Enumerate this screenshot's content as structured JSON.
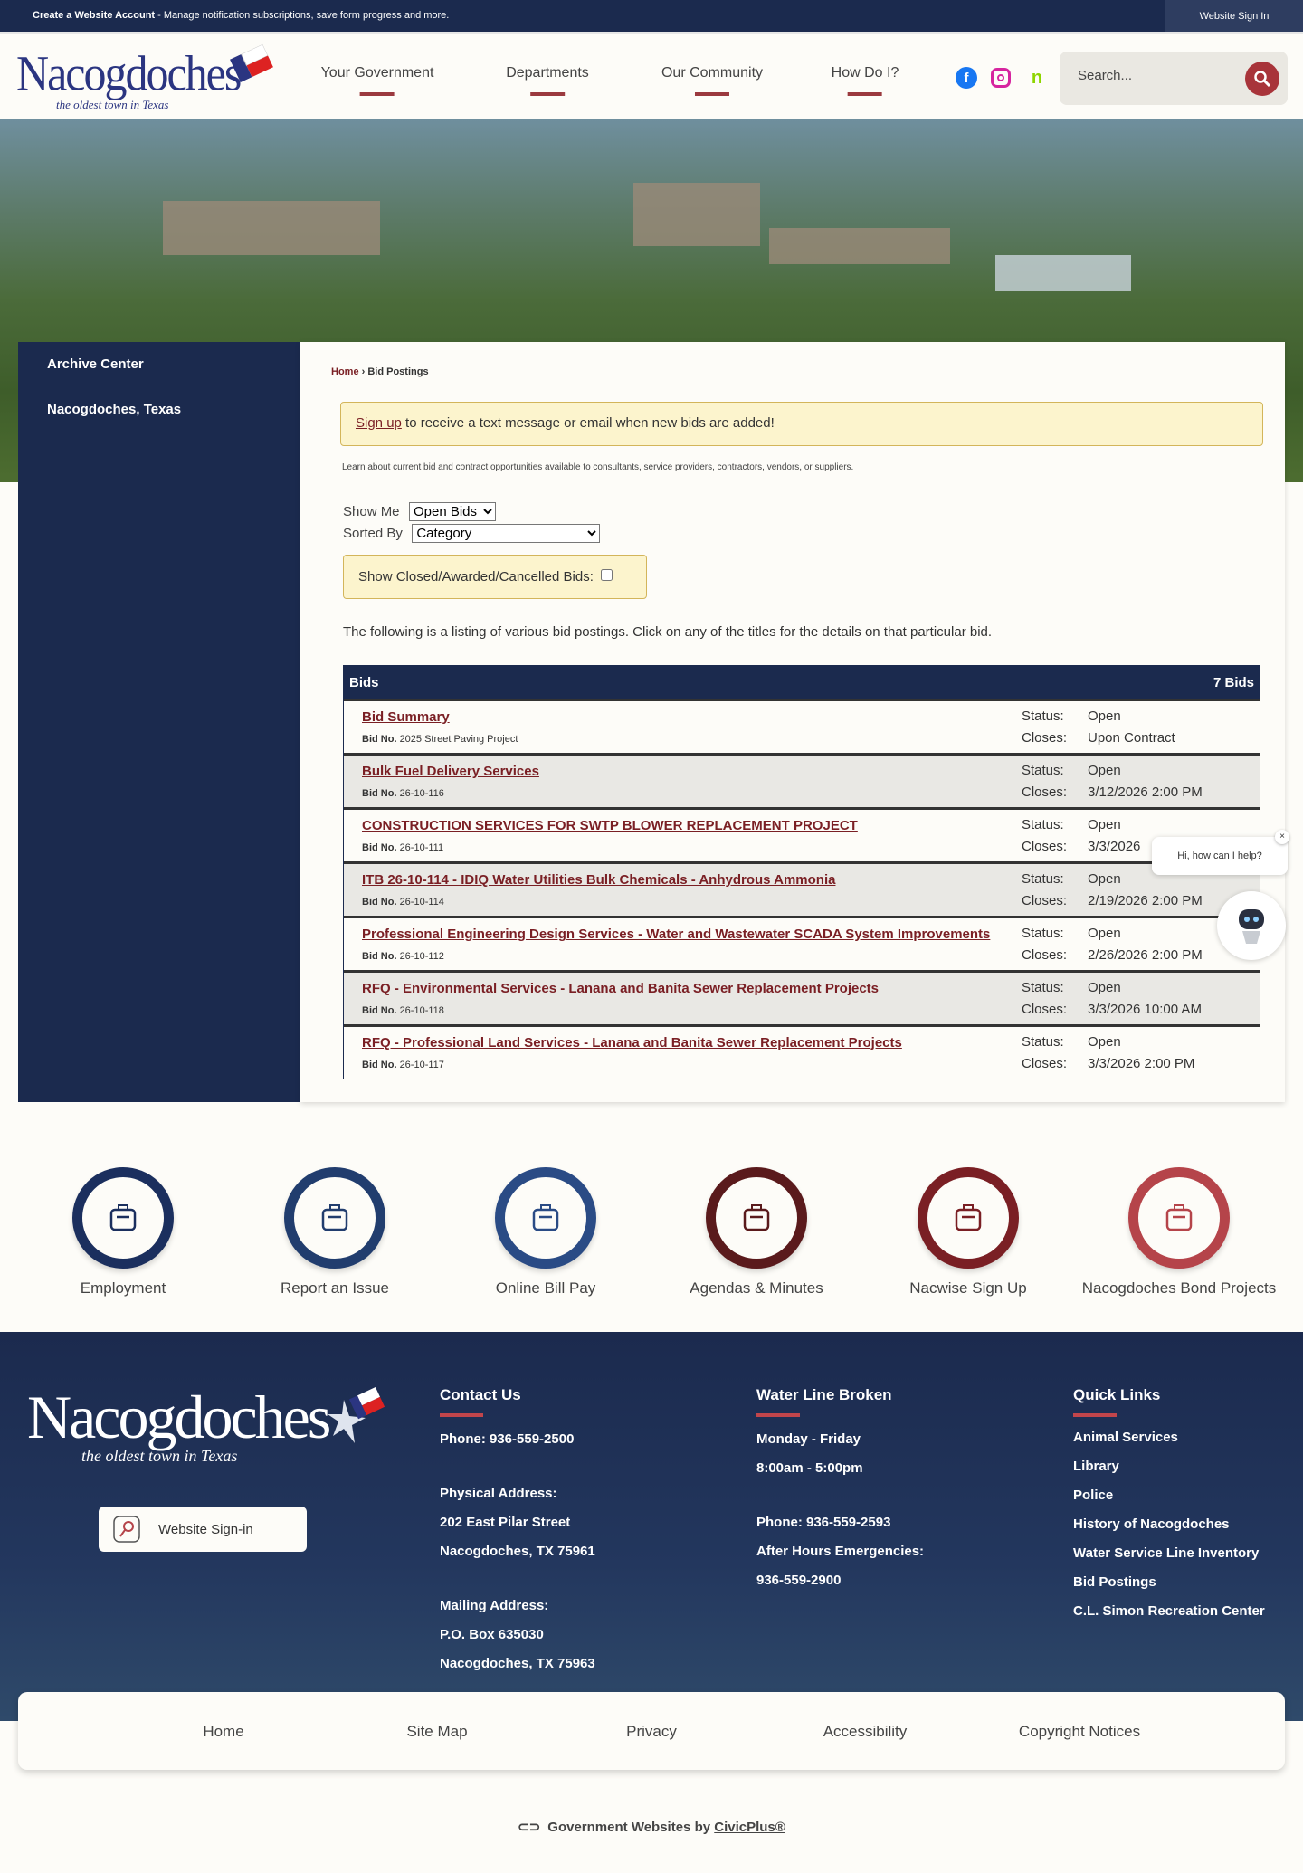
{
  "topbar": {
    "create_account": "Create a Website Account",
    "create_account_desc": " - Manage notification subscriptions, save form progress and more.",
    "sign_in": "Website Sign In"
  },
  "header": {
    "logo_name": "Nacogdoches",
    "logo_tagline": "the oldest town in Texas",
    "nav": [
      "Your Government",
      "Departments",
      "Our Community",
      "How Do I?"
    ],
    "social": [
      "facebook-icon",
      "instagram-icon",
      "nextdoor-icon"
    ],
    "search_placeholder": "Search..."
  },
  "sidebar": {
    "items": [
      "Archive Center",
      "Nacogdoches, Texas"
    ]
  },
  "breadcrumb": {
    "home": "Home",
    "sep": " › ",
    "current": "Bid Postings"
  },
  "alert": {
    "link": "Sign up",
    "text": " to receive a text message or email when new bids are added!"
  },
  "intro": "Learn about current bid and contract opportunities available to consultants, service providers, contractors, vendors, or suppliers.",
  "filters": {
    "show_me_label": "Show Me",
    "show_me_value": "Open Bids",
    "sorted_by_label": "Sorted By",
    "sorted_by_value": "Category",
    "closed_label": "Show Closed/Awarded/Cancelled Bids:"
  },
  "listing_text": "The following is a listing of various bid postings. Click on any of the titles for the details on that particular bid.",
  "table": {
    "title": "Bids",
    "count": "7 Bids",
    "bid_no_label": "Bid No.",
    "status_label": "Status:",
    "closes_label": "Closes:",
    "rows": [
      {
        "title": "Bid Summary",
        "bid_no": "2025 Street Paving Project",
        "status": "Open",
        "closes": "Upon Contract"
      },
      {
        "title": "Bulk Fuel Delivery Services",
        "bid_no": "26-10-116",
        "status": "Open",
        "closes": "3/12/2026 2:00 PM"
      },
      {
        "title": "CONSTRUCTION SERVICES FOR SWTP BLOWER REPLACEMENT PROJECT",
        "bid_no": "26-10-111",
        "status": "Open",
        "closes": "3/3/2026"
      },
      {
        "title": "ITB 26-10-114 - IDIQ Water Utilities Bulk Chemicals - Anhydrous Ammonia",
        "bid_no": "26-10-114",
        "status": "Open",
        "closes": "2/19/2026 2:00 PM"
      },
      {
        "title": "Professional Engineering Design Services - Water and Wastewater SCADA System Improvements",
        "bid_no": "26-10-112",
        "status": "Open",
        "closes": "2/26/2026 2:00 PM"
      },
      {
        "title": "RFQ - Environmental Services - Lanana and Banita Sewer Replacement Projects",
        "bid_no": "26-10-118",
        "status": "Open",
        "closes": "3/3/2026 10:00 AM"
      },
      {
        "title": "RFQ - Professional Land Services - Lanana and Banita Sewer Replacement Projects",
        "bid_no": "26-10-117",
        "status": "Open",
        "closes": "3/3/2026 2:00 PM"
      }
    ]
  },
  "chat": {
    "prompt": "Hi, how can I help?",
    "close": "×"
  },
  "quick_links": [
    {
      "label": "Employment",
      "color": "#1b2f5e"
    },
    {
      "label": "Report an Issue",
      "color": "#213d6e"
    },
    {
      "label": "Online Bill Pay",
      "color": "#2a4b85"
    },
    {
      "label": "Agendas & Minutes",
      "color": "#5a1a1c"
    },
    {
      "label": "Nacwise Sign Up",
      "color": "#7a1f24"
    },
    {
      "label": "Nacogdoches Bond Projects",
      "color": "#b5444a"
    }
  ],
  "footer": {
    "logo_name": "Nacogdoches",
    "logo_tagline": "the oldest town in Texas",
    "sign_in": "Website Sign-in",
    "contact": {
      "title": "Contact Us",
      "phone": "Phone: 936-559-2500",
      "physical_label": "Physical Address:",
      "physical1": "202 East Pilar Street",
      "physical2": "Nacogdoches, TX 75961",
      "mailing_label": "Mailing Address:",
      "mailing1": "P.O. Box 635030",
      "mailing2": "Nacogdoches, TX 75963"
    },
    "water": {
      "title": "Water Line Broken",
      "days": "Monday - Friday",
      "hours": "8:00am - 5:00pm",
      "phone": "Phone: 936-559-2593",
      "after_label": "After Hours Emergencies:",
      "after_phone": "936-559-2900"
    },
    "quick": {
      "title": "Quick Links",
      "items": [
        "Animal Services",
        "Library",
        "Police",
        "History of Nacogdoches",
        "Water Service Line Inventory",
        "Bid Postings",
        "C.L. Simon Recreation Center"
      ]
    },
    "bottom_links": [
      "Home",
      "Site Map",
      "Privacy",
      "Accessibility",
      "Copyright Notices"
    ],
    "civic_text": "Government Websites by ",
    "civic_link": "CivicPlus®"
  }
}
